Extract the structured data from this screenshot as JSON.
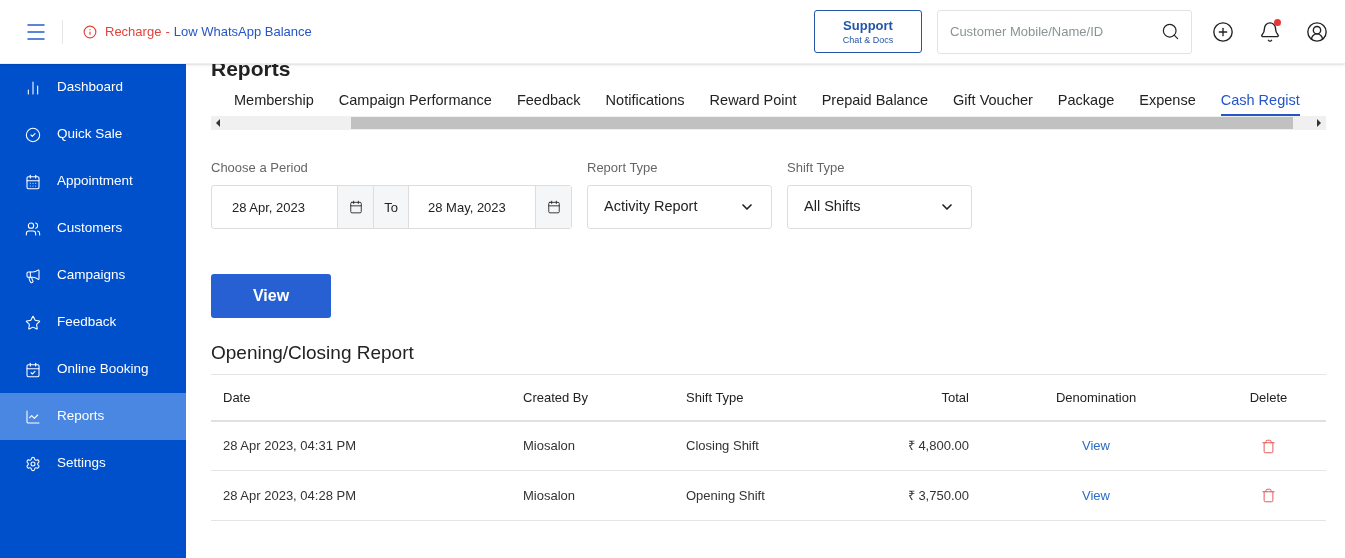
{
  "header": {
    "alert_prefix": "Recharge",
    "alert_separator": "-",
    "alert_link": "Low WhatsApp Balance",
    "support": {
      "title": "Support",
      "subtitle": "Chat & Docs"
    },
    "search": {
      "placeholder": "Customer Mobile/Name/ID"
    }
  },
  "sidebar": {
    "items": [
      {
        "label": "Dashboard",
        "selected": false
      },
      {
        "label": "Quick Sale",
        "selected": false
      },
      {
        "label": "Appointment",
        "selected": false
      },
      {
        "label": "Customers",
        "selected": false
      },
      {
        "label": "Campaigns",
        "selected": false
      },
      {
        "label": "Feedback",
        "selected": false
      },
      {
        "label": "Online Booking",
        "selected": false
      },
      {
        "label": "Reports",
        "selected": true
      },
      {
        "label": "Settings",
        "selected": false
      }
    ]
  },
  "page": {
    "title": "Reports",
    "tabs": [
      {
        "label": "Membership",
        "selected": false
      },
      {
        "label": "Campaign Performance",
        "selected": false
      },
      {
        "label": "Feedback",
        "selected": false
      },
      {
        "label": "Notifications",
        "selected": false
      },
      {
        "label": "Reward Point",
        "selected": false
      },
      {
        "label": "Prepaid Balance",
        "selected": false
      },
      {
        "label": "Gift Voucher",
        "selected": false
      },
      {
        "label": "Package",
        "selected": false
      },
      {
        "label": "Expense",
        "selected": false
      },
      {
        "label": "Cash Regist",
        "selected": true
      }
    ],
    "filters": {
      "period_label": "Choose a Period",
      "from": "28 Apr, 2023",
      "to_label": "To",
      "to": "28 May, 2023",
      "report_type_label": "Report Type",
      "report_type": "Activity Report",
      "shift_type_label": "Shift Type",
      "shift_type": "All Shifts"
    },
    "view_button": "View",
    "report_title": "Opening/Closing Report",
    "table": {
      "columns": [
        "Date",
        "Created By",
        "Shift Type",
        "Total",
        "Denomination",
        "Delete"
      ],
      "rows": [
        {
          "date": "28 Apr 2023, 04:31 PM",
          "created_by": "Miosalon",
          "shift_type": "Closing Shift",
          "total": "₹ 4,800.00",
          "denomination": "View"
        },
        {
          "date": "28 Apr 2023, 04:28 PM",
          "created_by": "Miosalon",
          "shift_type": "Opening Shift",
          "total": "₹ 3,750.00",
          "denomination": "View"
        }
      ]
    }
  }
}
